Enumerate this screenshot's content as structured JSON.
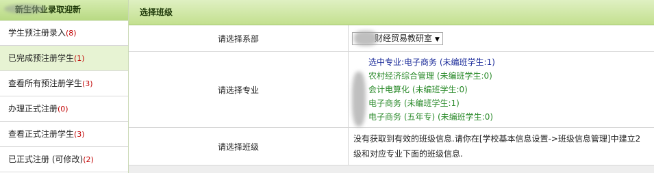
{
  "sidebar": {
    "header": "新生休业录取迎新",
    "items": [
      {
        "label": "学生预注册录入",
        "count": "(8)",
        "active": false
      },
      {
        "label": "已完成预注册学生",
        "count": "(1)",
        "active": true
      },
      {
        "label": "查看所有预注册学生",
        "count": "(3)",
        "active": false
      },
      {
        "label": "办理正式注册",
        "count": "(0)",
        "active": false
      },
      {
        "label": "查看正式注册学生",
        "count": "(3)",
        "active": false
      },
      {
        "label": "已正式注册 (可修改)",
        "count": "(2)",
        "active": false
      }
    ]
  },
  "main": {
    "header": "选择班级",
    "rows": {
      "department_label": "请选择系部",
      "department_value": "财经贸易教研室",
      "major_label": "请选择专业",
      "class_label": "请选择班级"
    },
    "majors": [
      {
        "text": "选中专业:电子商务 (未编班学生:1)",
        "selected": true
      },
      {
        "text": "农村经济综合管理 (未编班学生:0)",
        "selected": false
      },
      {
        "text": "会计电算化 (未编班学生:0)",
        "selected": false
      },
      {
        "text": "电子商务 (未编班学生:1)",
        "selected": false
      },
      {
        "text": "电子商务 (五年专) (未编班学生:0)",
        "selected": false
      }
    ],
    "class_message_line1": "没有获取到有效的班级信息.请你在[学校基本信息设置->班级信息管理]中建立2",
    "class_message_line2": "级和对应专业下面的班级信息."
  },
  "colors": {
    "green_header": "#c3e08f",
    "active_bg": "#e7f3d3",
    "count_red": "#c00000",
    "major_green": "#2a8a2a",
    "major_selected": "#1a2a99"
  }
}
